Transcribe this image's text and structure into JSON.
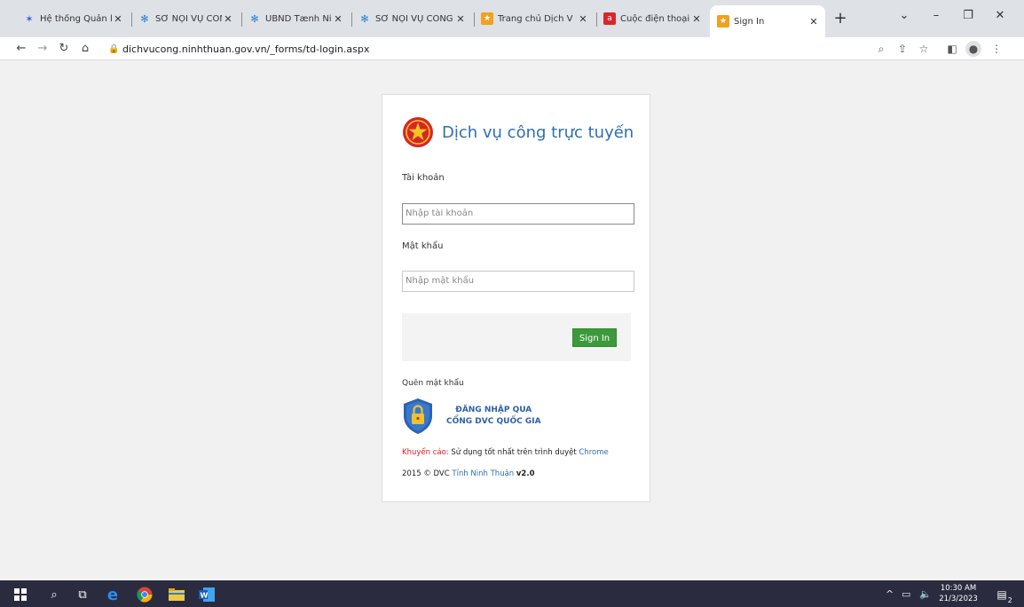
{
  "browser": {
    "tabs": [
      {
        "title": "Hệ thống Quản lý",
        "icon": "edge-favicon"
      },
      {
        "title": "SỞ NỘI VỤ CÔNG",
        "icon": "gov-favicon"
      },
      {
        "title": "UBND Tænh Ninh",
        "icon": "gov-favicon"
      },
      {
        "title": "SỞ NỘI VỤ CÔNG",
        "icon": "gov-favicon"
      },
      {
        "title": "Trang chủ Dịch V",
        "icon": "dvc-favicon"
      },
      {
        "title": "Cuộc điện thoại c",
        "icon": "phone-favicon"
      },
      {
        "title": "Sign In",
        "icon": "dvc-favicon"
      }
    ],
    "url": "dichvucong.ninhthuan.gov.vn/_forms/td-login.aspx"
  },
  "login": {
    "title": "Dịch vụ công trực tuyến",
    "account_label": "Tài khoản",
    "account_placeholder": "Nhập tài khoản",
    "password_label": "Mật khẩu",
    "password_placeholder": "Nhập mật khẩu",
    "signin_label": "Sign In",
    "forgot_label": "Quên mật khẩu",
    "national_portal_line1": "ĐĂNG NHẬP QUA",
    "national_portal_line2": "CỔNG DVC QUỐC GIA",
    "note_warn": "Khuyến cáo:",
    "note_text": " Sử dụng tốt nhất trên trình duyệt ",
    "note_browser": "Chrome",
    "copyright_prefix": "2015 © DVC ",
    "copyright_org": "Tỉnh Ninh Thuận",
    "copyright_version": "v2.0"
  },
  "taskbar": {
    "time": "10:30 AM",
    "date": "21/3/2023",
    "notification_count": "2"
  },
  "colors": {
    "accent": "#2f6fb0",
    "signin_button": "#3c9a3c",
    "warning": "#e21b1b"
  }
}
